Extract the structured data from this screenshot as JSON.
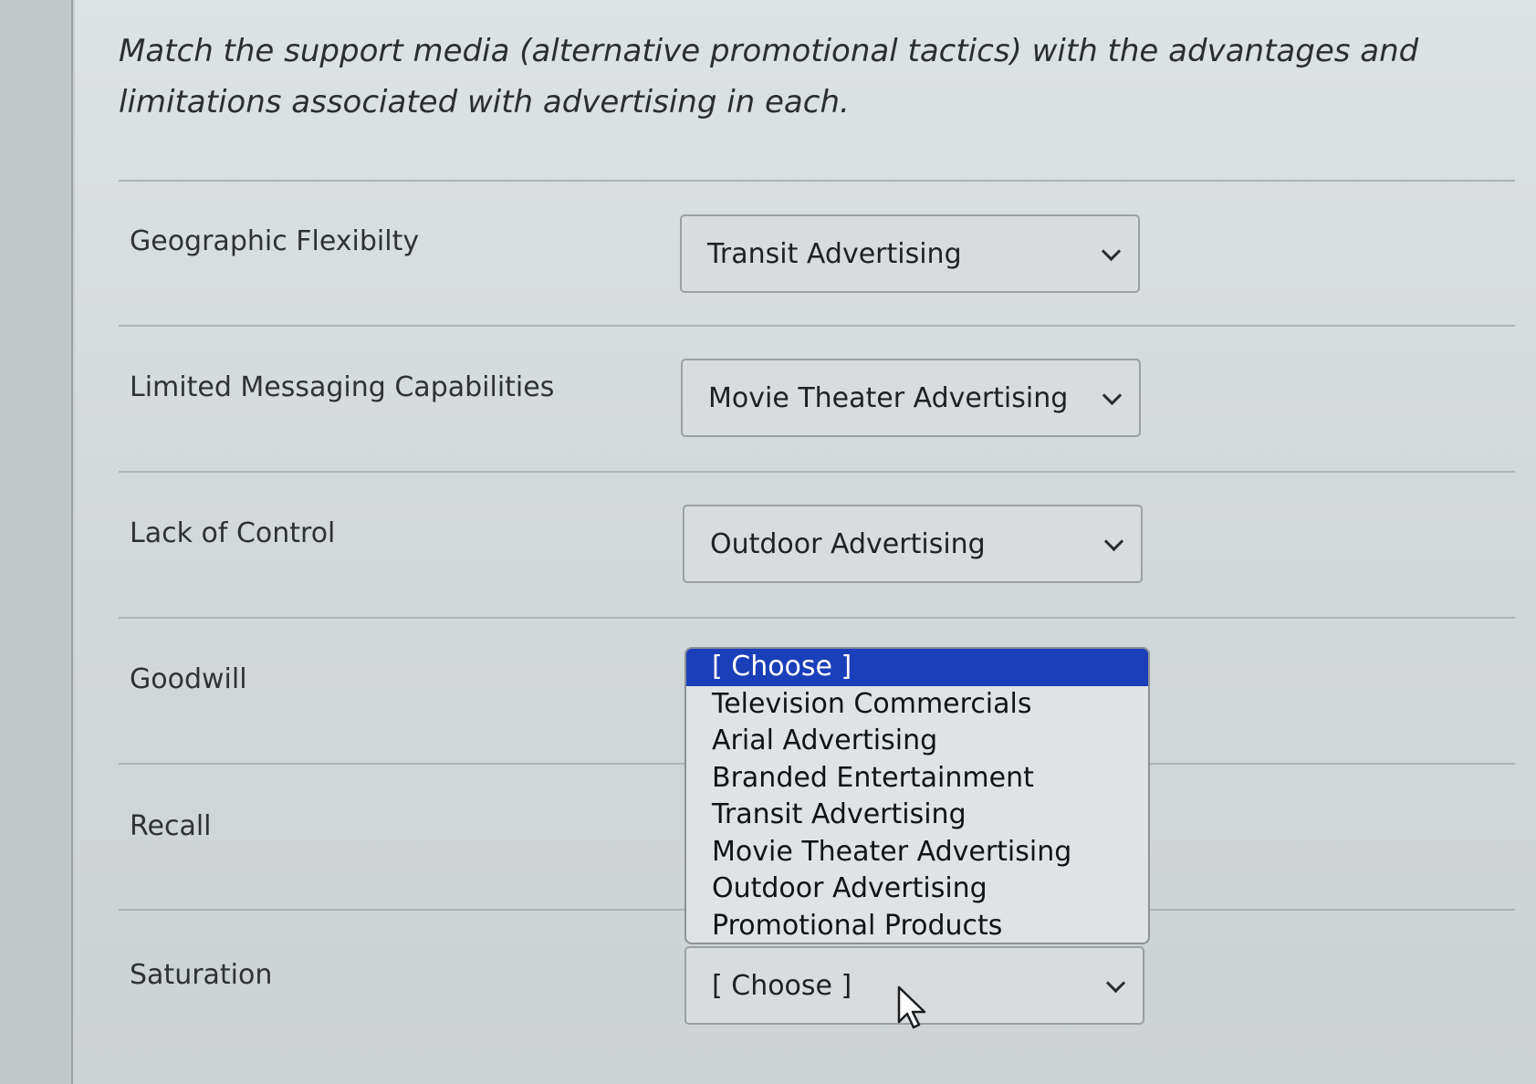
{
  "question": "Match the support media (alternative promotional tactics) with the advantages and limitations associated with advertising in each.",
  "rows": [
    {
      "label": "Geographic Flexibilty",
      "selected": "Transit Advertising"
    },
    {
      "label": "Limited Messaging Capabilities",
      "selected": "Movie Theater Advertising"
    },
    {
      "label": "Lack of Control",
      "selected": "Outdoor Advertising"
    },
    {
      "label": "Goodwill",
      "selected": "[ Choose ]"
    },
    {
      "label": "Recall",
      "selected": ""
    },
    {
      "label": "Saturation",
      "selected": "[ Choose ]"
    }
  ],
  "open_dropdown": {
    "highlighted": "[ Choose ]",
    "options": [
      "[ Choose ]",
      "Television Commercials",
      "Arial Advertising",
      "Branded Entertainment",
      "Transit Advertising",
      "Movie Theater Advertising",
      "Outdoor Advertising",
      "Promotional Products"
    ]
  },
  "icons": {
    "dropdown_arrow": "chevron-down-icon",
    "pointer": "mouse-cursor-icon"
  }
}
